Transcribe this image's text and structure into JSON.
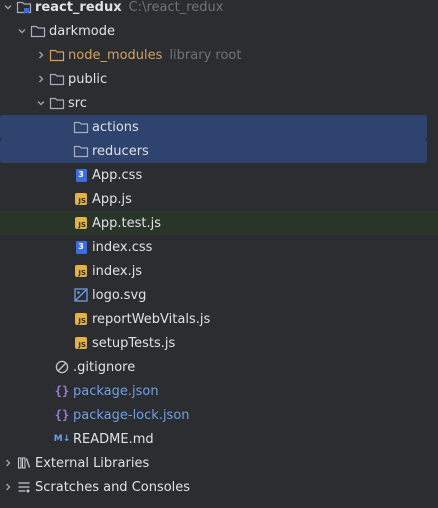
{
  "project": {
    "name": "react_redux",
    "path": "C:\\react_redux"
  },
  "tree": {
    "darkmode": "darkmode",
    "node_modules": {
      "name": "node_modules",
      "hint": "library root"
    },
    "public": "public",
    "src": "src",
    "actions": "actions",
    "reducers": "reducers",
    "files": {
      "app_css": "App.css",
      "app_js": "App.js",
      "app_test_js": "App.test.js",
      "index_css": "index.css",
      "index_js": "index.js",
      "logo_svg": "logo.svg",
      "report": "reportWebVitals.js",
      "setup": "setupTests.js",
      "gitignore": ".gitignore",
      "package": "package.json",
      "package_lock": "package-lock.json",
      "readme": "README.md"
    },
    "external": "External Libraries",
    "scratches": "Scratches and Consoles"
  },
  "icons": {
    "chevron_down": "chevron-down-icon",
    "chevron_right": "chevron-right-icon",
    "folder": "folder-icon",
    "js": "js-file-icon",
    "css": "css-file-icon",
    "svg": "image-file-icon",
    "json": "json-file-icon",
    "md": "markdown-file-icon",
    "ignore": "ignore-file-icon"
  },
  "badges": {
    "js": "JS",
    "css": "3",
    "json": "{}",
    "md": "M↓"
  },
  "colors": {
    "selection": "#2e436e",
    "excluded": "#d5a05f",
    "modified": "#6f9fe6"
  }
}
